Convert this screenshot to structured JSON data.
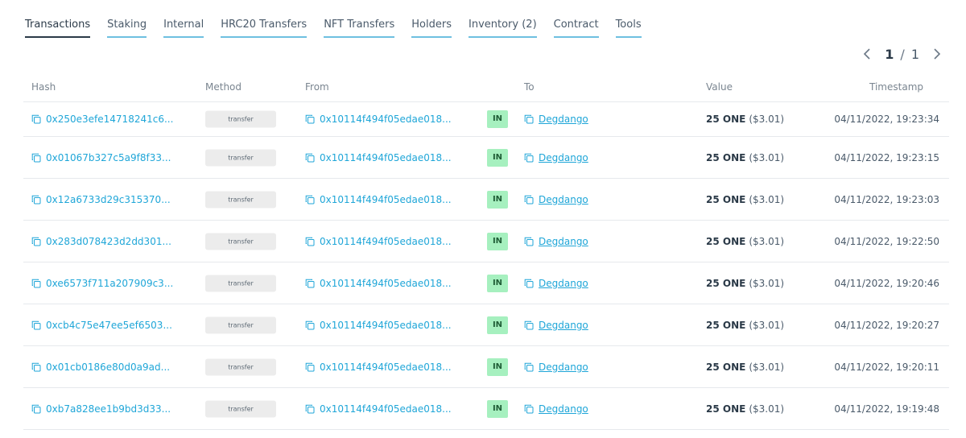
{
  "tabs": [
    {
      "label": "Transactions",
      "active": true
    },
    {
      "label": "Staking",
      "active": false
    },
    {
      "label": "Internal",
      "active": false
    },
    {
      "label": "HRC20 Transfers",
      "active": false
    },
    {
      "label": "NFT Transfers",
      "active": false
    },
    {
      "label": "Holders",
      "active": false
    },
    {
      "label": "Inventory (2)",
      "active": false
    },
    {
      "label": "Contract",
      "active": false
    },
    {
      "label": "Tools",
      "active": false
    }
  ],
  "pagination": {
    "current": "1",
    "separator": "/",
    "total": "1"
  },
  "table": {
    "headers": {
      "hash": "Hash",
      "method": "Method",
      "from": "From",
      "to": "To",
      "value": "Value",
      "timestamp": "Timestamp"
    },
    "rows": [
      {
        "hash": "0x250e3efe14718241c6...",
        "method": "transfer",
        "from": "0x10114f494f05edae018...",
        "direction": "IN",
        "to": "Degdango",
        "amount": "25 ONE",
        "usd": "($3.01)",
        "timestamp": "04/11/2022, 19:23:34"
      },
      {
        "hash": "0x01067b327c5a9f8f33...",
        "method": "transfer",
        "from": "0x10114f494f05edae018...",
        "direction": "IN",
        "to": "Degdango",
        "amount": "25 ONE",
        "usd": "($3.01)",
        "timestamp": "04/11/2022, 19:23:15"
      },
      {
        "hash": "0x12a6733d29c315370...",
        "method": "transfer",
        "from": "0x10114f494f05edae018...",
        "direction": "IN",
        "to": "Degdango",
        "amount": "25 ONE",
        "usd": "($3.01)",
        "timestamp": "04/11/2022, 19:23:03"
      },
      {
        "hash": "0x283d078423d2dd301...",
        "method": "transfer",
        "from": "0x10114f494f05edae018...",
        "direction": "IN",
        "to": "Degdango",
        "amount": "25 ONE",
        "usd": "($3.01)",
        "timestamp": "04/11/2022, 19:22:50"
      },
      {
        "hash": "0xe6573f711a207909c3...",
        "method": "transfer",
        "from": "0x10114f494f05edae018...",
        "direction": "IN",
        "to": "Degdango",
        "amount": "25 ONE",
        "usd": "($3.01)",
        "timestamp": "04/11/2022, 19:20:46"
      },
      {
        "hash": "0xcb4c75e47ee5ef6503...",
        "method": "transfer",
        "from": "0x10114f494f05edae018...",
        "direction": "IN",
        "to": "Degdango",
        "amount": "25 ONE",
        "usd": "($3.01)",
        "timestamp": "04/11/2022, 19:20:27"
      },
      {
        "hash": "0x01cb0186e80d0a9ad...",
        "method": "transfer",
        "from": "0x10114f494f05edae018...",
        "direction": "IN",
        "to": "Degdango",
        "amount": "25 ONE",
        "usd": "($3.01)",
        "timestamp": "04/11/2022, 19:20:11"
      },
      {
        "hash": "0xb7a828ee1b9bd3d33...",
        "method": "transfer",
        "from": "0x10114f494f05edae018...",
        "direction": "IN",
        "to": "Degdango",
        "amount": "25 ONE",
        "usd": "($3.01)",
        "timestamp": "04/11/2022, 19:19:48"
      }
    ]
  },
  "icons": {
    "copy": "copy-icon",
    "prev": "chevron-left-icon",
    "next": "chevron-right-icon"
  },
  "colors": {
    "link": "#1fa6d8",
    "tab_underline": "#6ec0e0",
    "in_badge": "#a6f0bf"
  }
}
